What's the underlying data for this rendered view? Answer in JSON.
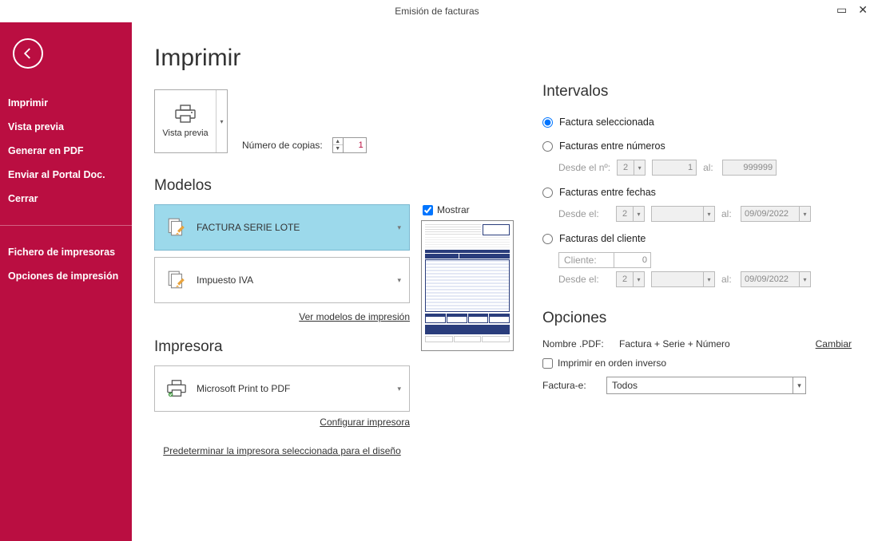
{
  "titlebar": {
    "title": "Emisión de facturas"
  },
  "sidebar": {
    "items": [
      {
        "label": "Imprimir",
        "bold": true
      },
      {
        "label": "Vista previa",
        "bold": true
      },
      {
        "label": "Generar en PDF",
        "bold": true
      },
      {
        "label": "Enviar al Portal Doc.",
        "bold": true
      },
      {
        "label": "Cerrar",
        "bold": true
      }
    ],
    "items2": [
      {
        "label": "Fichero de impresoras",
        "bold": true
      },
      {
        "label": "Opciones de impresión",
        "bold": true
      }
    ]
  },
  "page": {
    "title": "Imprimir"
  },
  "preview_btn": {
    "label": "Vista previa"
  },
  "copies": {
    "label": "Número de copias:",
    "value": "1"
  },
  "sections": {
    "modelos": "Modelos",
    "impresora": "Impresora",
    "intervalos": "Intervalos",
    "opciones": "Opciones"
  },
  "models": {
    "selected": "FACTURA SERIE LOTE",
    "secondary": "Impuesto IVA",
    "link": "Ver modelos de impresión"
  },
  "show_preview": {
    "label": "Mostrar",
    "checked": true
  },
  "printer": {
    "name": "Microsoft Print to PDF",
    "configure_link": "Configurar impresora",
    "default_link": "Predeterminar la impresora seleccionada para el diseño"
  },
  "intervals": {
    "r1": "Factura seleccionada",
    "r2": "Facturas entre números",
    "r2_desde": "Desde el nº:",
    "r2_serie": "2",
    "r2_from": "1",
    "r2_al": "al:",
    "r2_to": "999999",
    "r3": "Facturas entre fechas",
    "r3_desde": "Desde el:",
    "r3_serie": "2",
    "r3_al": "al:",
    "r3_to": "09/09/2022",
    "r4": "Facturas del cliente",
    "r4_cliente_lbl": "Cliente:",
    "r4_cliente_val": "0",
    "r4_desde": "Desde el:",
    "r4_serie": "2",
    "r4_al": "al:",
    "r4_to": "09/09/2022"
  },
  "options": {
    "pdf_lbl": "Nombre .PDF:",
    "pdf_val": "Factura + Serie + Número",
    "pdf_change": "Cambiar",
    "reverse": "Imprimir en orden inverso",
    "facturae_lbl": "Factura-e:",
    "facturae_val": "Todos"
  }
}
